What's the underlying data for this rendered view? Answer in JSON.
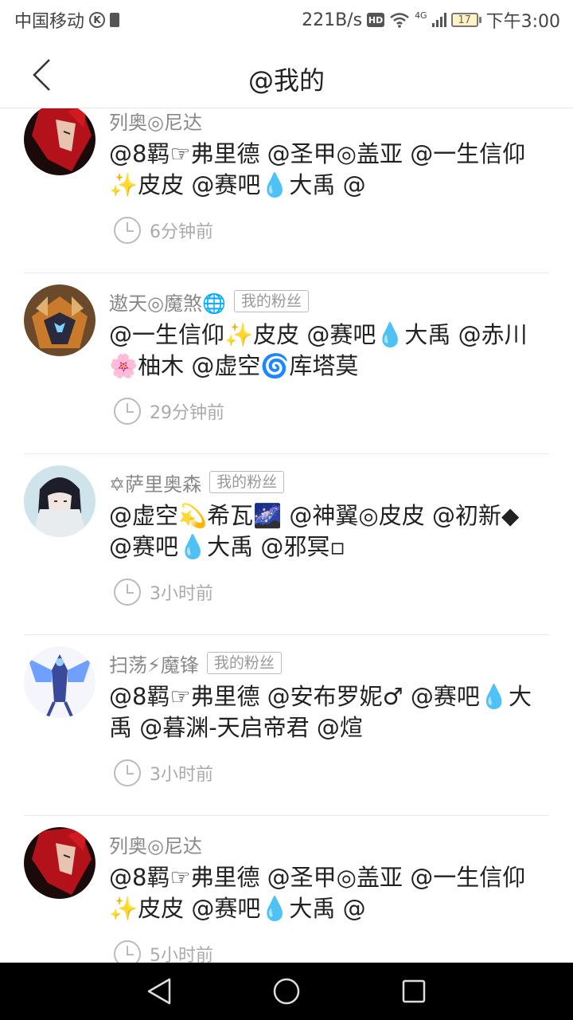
{
  "status_bar": {
    "carrier": "中国移动",
    "net_speed": "221B/s",
    "hd": "HD",
    "network_type": "4G",
    "battery": "17",
    "time": "下午3:00"
  },
  "header": {
    "title": "@我的"
  },
  "messages": [
    {
      "username": "列奥◎尼达",
      "badge": "",
      "text": "@8羁☞弗里德 @圣甲◎盖亚 @一生信仰✨皮皮 @赛吧💧大禹 @",
      "time": "6分钟前",
      "avatar": "red-hair-avatar"
    },
    {
      "username": "遨天◎魔煞🌐",
      "badge": "我的粉丝",
      "text": "@一生信仰✨皮皮 @赛吧💧大禹 @赤川🌸柚木 @虚空🌀库塔莫",
      "time": "29分钟前",
      "avatar": "armored-avatar"
    },
    {
      "username": "✡萨里奥森",
      "badge": "我的粉丝",
      "text": "@虚空💫希瓦🌌 @神翼◎皮皮 @初新◆ @赛吧💧大禹 @邪冥▫",
      "time": "3小时前",
      "avatar": "dark-hair-avatar"
    },
    {
      "username": "扫荡⚡魔锋",
      "badge": "我的粉丝",
      "text": "@8羁☞弗里德 @安布罗妮♂ @赛吧💧大禹 @暮渊-天启帝君 @煊",
      "time": "3小时前",
      "avatar": "mech-avatar"
    },
    {
      "username": "列奥◎尼达",
      "badge": "",
      "text": "@8羁☞弗里德 @圣甲◎盖亚 @一生信仰✨皮皮 @赛吧💧大禹 @",
      "time": "5小时前",
      "avatar": "red-hair-avatar"
    }
  ],
  "colors": {
    "text": "#222222",
    "secondary": "#888888",
    "divider": "#e8e8e8",
    "nav_bar": "#000000"
  }
}
